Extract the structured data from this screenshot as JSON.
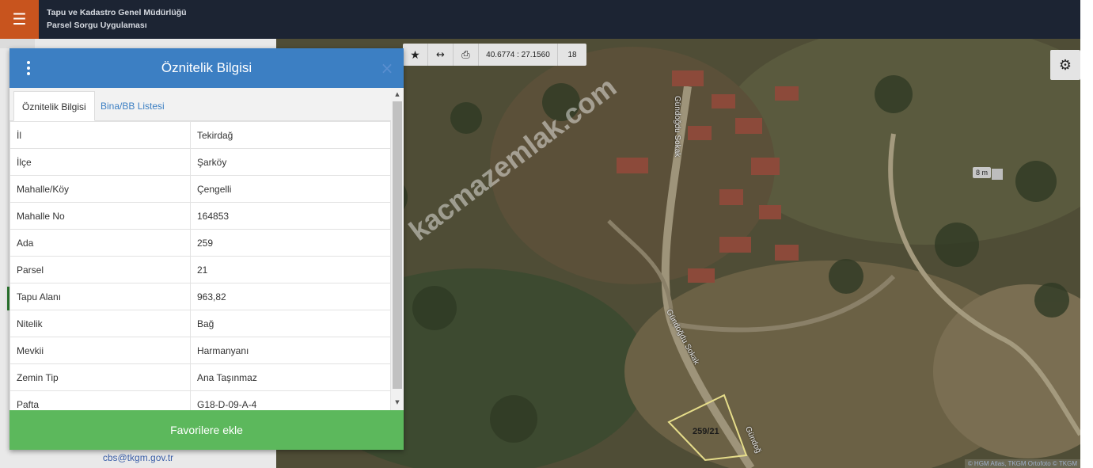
{
  "header": {
    "title_line1": "Tapu ve Kadastro Genel Müdürlüğü",
    "title_line2": "Parsel Sorgu Uygulaması"
  },
  "sidebar": {
    "email": "cbs@tkgm.gov.tr"
  },
  "map": {
    "coordinates": "40.6774 : 27.1560",
    "zoom": "18",
    "scale": "8 m",
    "watermark": "kacmazemlak.com",
    "parcel_label": "259/21",
    "road_labels": [
      "Gündoğdu Sokak",
      "Gündoğdu Sokak",
      "Gündoğ"
    ],
    "attribution": "© HGM Atlas, TKGM Ortofoto © TKGM"
  },
  "modal": {
    "title": "Öznitelik Bilgisi",
    "tabs": [
      {
        "label": "Öznitelik Bilgisi",
        "active": true
      },
      {
        "label": "Bina/BB Listesi",
        "active": false
      }
    ],
    "rows": [
      {
        "key": "İl",
        "value": "Tekirdağ"
      },
      {
        "key": "İlçe",
        "value": "Şarköy"
      },
      {
        "key": "Mahalle/Köy",
        "value": "Çengelli"
      },
      {
        "key": "Mahalle No",
        "value": "164853"
      },
      {
        "key": "Ada",
        "value": "259"
      },
      {
        "key": "Parsel",
        "value": "21"
      },
      {
        "key": "Tapu Alanı",
        "value": "963,82"
      },
      {
        "key": "Nitelik",
        "value": "Bağ"
      },
      {
        "key": "Mevkii",
        "value": "Harmanyanı"
      },
      {
        "key": "Zemin Tip",
        "value": "Ana Taşınmaz"
      },
      {
        "key": "Pafta",
        "value": "G18-D-09-A-4"
      }
    ],
    "favorite_button": "Favorilere ekle"
  },
  "colors": {
    "header_bg": "#1c2433",
    "menu_btn": "#c8541e",
    "modal_header": "#3c7fc3",
    "favorite_btn": "#5cb85c"
  }
}
